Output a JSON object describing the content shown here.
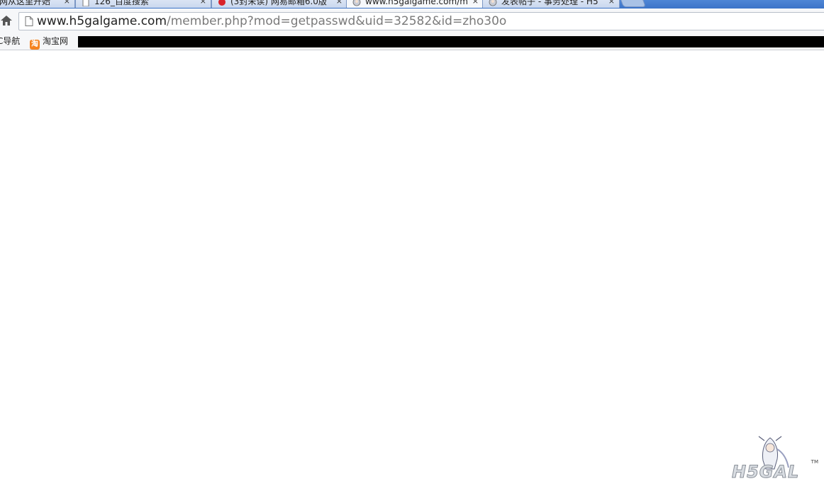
{
  "tabs": [
    {
      "title": "网从这里开始",
      "close": "×",
      "active": false
    },
    {
      "title": "126_百度搜索",
      "close": "×",
      "active": false
    },
    {
      "title": "(3封未读) 网易邮箱6.0版",
      "close": "×",
      "active": false
    },
    {
      "title": "www.h5galgame.com/m",
      "close": "×",
      "active": true
    },
    {
      "title": "发表帖子 - 事务处理 - H5",
      "close": "×",
      "active": false
    }
  ],
  "address_bar": {
    "host": "www.h5galgame.com",
    "path": "/member.php?mod=getpasswd&uid=32582&id=zho30o"
  },
  "bookmarks": [
    {
      "label": "C导航"
    },
    {
      "label": "淘宝网",
      "icon_glyph": "淘"
    }
  ],
  "logo": {
    "text": "H5GAL",
    "tm": "TM"
  },
  "colors": {
    "tabstrip": "#4f86d6",
    "toolbar": "#f6f7f9",
    "content_bg": "#ffffff",
    "url_host": "#222222",
    "url_path": "#7a7a7a"
  }
}
